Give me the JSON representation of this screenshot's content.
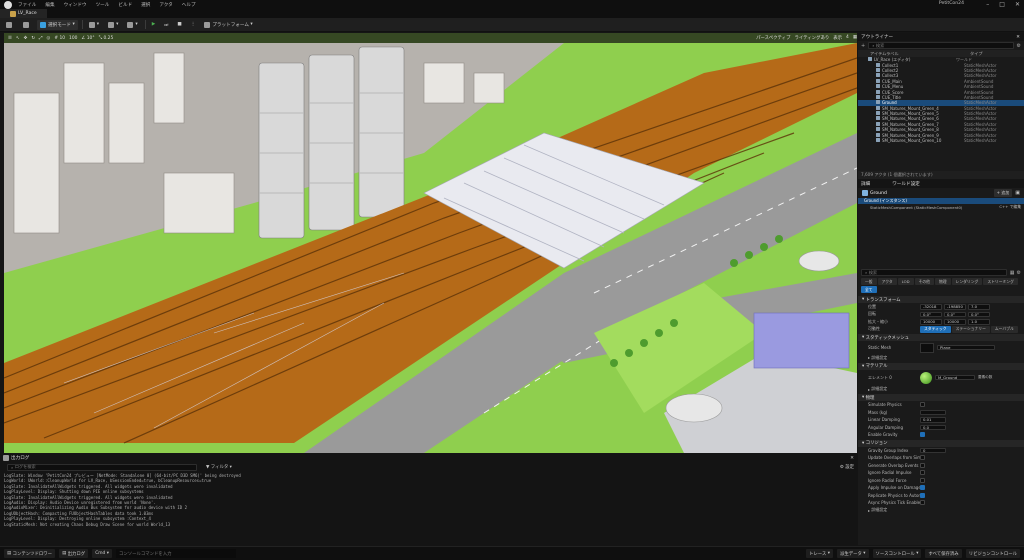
{
  "menu": {
    "items": [
      "ファイル",
      "編集",
      "ウィンドウ",
      "ツール",
      "ビルド",
      "選択",
      "アクタ",
      "ヘルプ"
    ],
    "project_name": "PetitCon24"
  },
  "tab": {
    "label": "LV_Race"
  },
  "toolbar": {
    "save_label": "",
    "mode_label": "選択モード",
    "platform_label": "プラットフォーム"
  },
  "viewport": {
    "perspective_label": "パースペクティブ",
    "lighting_label": "ライティングあり",
    "show_label": "表示",
    "grid_value": "10",
    "rotation_value": "10°",
    "scale_value": "0.25",
    "speed_value": "4",
    "fov_value": "100"
  },
  "outliner": {
    "title": "アウトライナー",
    "search_placeholder": "検索",
    "col_label": "アイテムラベル",
    "col_type": "タイプ",
    "rows": [
      {
        "name": "LV_Race (エディタ)",
        "type": "ワールド",
        "sel": false,
        "indent": 0
      },
      {
        "name": "Collect1",
        "type": "StaticMeshActor",
        "sel": false,
        "indent": 1
      },
      {
        "name": "Collect2",
        "type": "StaticMeshActor",
        "sel": false,
        "indent": 1
      },
      {
        "name": "Collect3",
        "type": "StaticMeshActor",
        "sel": false,
        "indent": 1
      },
      {
        "name": "CUE_Main",
        "type": "AmbientSound",
        "sel": false,
        "indent": 1
      },
      {
        "name": "CUE_Menu",
        "type": "AmbientSound",
        "sel": false,
        "indent": 1
      },
      {
        "name": "CUE_Score",
        "type": "AmbientSound",
        "sel": false,
        "indent": 1
      },
      {
        "name": "CUE_Title",
        "type": "AmbientSound",
        "sel": false,
        "indent": 1
      },
      {
        "name": "Ground",
        "type": "StaticMeshActor",
        "sel": true,
        "indent": 1
      },
      {
        "name": "SM_Natures_Mount_Green_4",
        "type": "StaticMeshActor",
        "sel": false,
        "indent": 1
      },
      {
        "name": "SM_Natures_Mount_Green_5",
        "type": "StaticMeshActor",
        "sel": false,
        "indent": 1
      },
      {
        "name": "SM_Natures_Mount_Green_6",
        "type": "StaticMeshActor",
        "sel": false,
        "indent": 1
      },
      {
        "name": "SM_Natures_Mount_Green_7",
        "type": "StaticMeshActor",
        "sel": false,
        "indent": 1
      },
      {
        "name": "SM_Natures_Mount_Green_8",
        "type": "StaticMeshActor",
        "sel": false,
        "indent": 1
      },
      {
        "name": "SM_Natures_Mount_Green_9",
        "type": "StaticMeshActor",
        "sel": false,
        "indent": 1
      },
      {
        "name": "SM_Natures_Mount_Green_10",
        "type": "StaticMeshActor",
        "sel": false,
        "indent": 1
      }
    ],
    "footer": "7,609 アクタ (1 個選択されています)"
  },
  "details": {
    "tab_details": "詳細",
    "tab_world": "ワールド設定",
    "actor_name": "Ground",
    "add_label": "+ 追加",
    "component_root": "Ground (インスタンス)",
    "component_child": "StaticMeshComponent (StaticMeshComponent0)",
    "component_child_btn": "C++ で編集",
    "search_placeholder": "検索",
    "filter_tabs": [
      "一般",
      "アクタ",
      "LOD",
      "その他",
      "物理",
      "レンダリング",
      "ストリーミング",
      "全て"
    ],
    "transform_title": "トランスフォーム",
    "location_label": "位置",
    "rotation_label": "回転",
    "scale_label": "拡大・縮小",
    "location": [
      "-32018",
      "-198850",
      "7.0"
    ],
    "rotation": [
      "0.0°",
      "0.0°",
      "0.0°"
    ],
    "scale": [
      "10000",
      "10000",
      "1.0"
    ],
    "mobility_label": "可動性",
    "mobility_options": [
      "スタティック",
      "ステーショナリー",
      "ムーバブル"
    ],
    "static_mesh_section": "スタティックメッシュ",
    "static_mesh_label": "Static Mesh",
    "static_mesh_value": "Plane",
    "advanced_label": "詳細設定",
    "materials_section": "マテリアル",
    "element_label": "エレメント 0",
    "material_value": "M_Ground",
    "material_index": "要素の数",
    "physics_section": "物理",
    "physics_rows": [
      {
        "label": "Simulate Physics",
        "kind": "check",
        "on": false
      },
      {
        "label": "Mass (kg)",
        "kind": "field",
        "value": ""
      },
      {
        "label": "Linear Damping",
        "kind": "field",
        "value": "0.01"
      },
      {
        "label": "Angular Damping",
        "kind": "field",
        "value": "0.0"
      },
      {
        "label": "Enable Gravity",
        "kind": "check",
        "on": true
      }
    ],
    "collision_section": "コリジョン",
    "collision_rows": [
      {
        "label": "Gravity Group Index",
        "kind": "field",
        "value": "0"
      },
      {
        "label": "Update Overlaps from Simulation",
        "kind": "check",
        "on": false
      },
      {
        "label": "Generate Overlap Events",
        "kind": "check",
        "on": false
      },
      {
        "label": "Ignore Radial Impulse",
        "kind": "check",
        "on": false
      },
      {
        "label": "Ignore Radial Force",
        "kind": "check",
        "on": false
      },
      {
        "label": "Apply Impulse on Damage",
        "kind": "check",
        "on": true
      },
      {
        "label": "Replicate Physics to Autonomous",
        "kind": "check",
        "on": true
      },
      {
        "label": "Async Physics Tick Enabled",
        "kind": "check",
        "on": false
      }
    ],
    "lod_section": "詳細設定"
  },
  "outlog": {
    "title": "出力ログ",
    "search_placeholder": "ログを検索",
    "filter_label": "フィルタ",
    "settings_label": "設定",
    "lines": [
      "LogSlate: Window 'PetitCon24 プレビュー [NetMode: Standalone 0] (64-bit/PC D3D SM6)' being destroyed",
      "LogWorld: UWorld::CleanupWorld for LV_Race, bSessionEnded=true, bCleanupResources=true",
      "LogSlate: InvalidateAllWidgets triggered.  All widgets were invalidated",
      "LogPlayLevel: Display: Shutting down PIE online subsystems",
      "LogSlate: InvalidateAllWidgets triggered.  All widgets were invalidated",
      "LogAudio: Display: Audio Device unregistered from world 'None'.",
      "LogAudioMixer: Deinitializing Audio Bus Subsystem for audio device with ID 2",
      "LogUObjectHash: Compacting FUObjectHashTables data took   1.03ms",
      "LogPlayLevel: Display: Destroying online subsystem :Context_4",
      "LogStaticMesh: Not creating Chaos Debug Draw Scene for world World_13"
    ]
  },
  "statusbar": {
    "content_drawer": "コンテンツドロワー",
    "output_log": "出力ログ",
    "cmd": "Cmd",
    "console_placeholder": "コンソールコマンドを入力",
    "trace": "トレース",
    "derived_data": "派生データ",
    "source_control": "ソースコントロール",
    "save_all": "すべて保存済み",
    "revision": "リビジョンコントロール"
  },
  "colors": {
    "accent": "#1f6fb8",
    "grass": "#8fcf4e",
    "rail": "#c97a1f",
    "road": "#9a9a9a"
  }
}
